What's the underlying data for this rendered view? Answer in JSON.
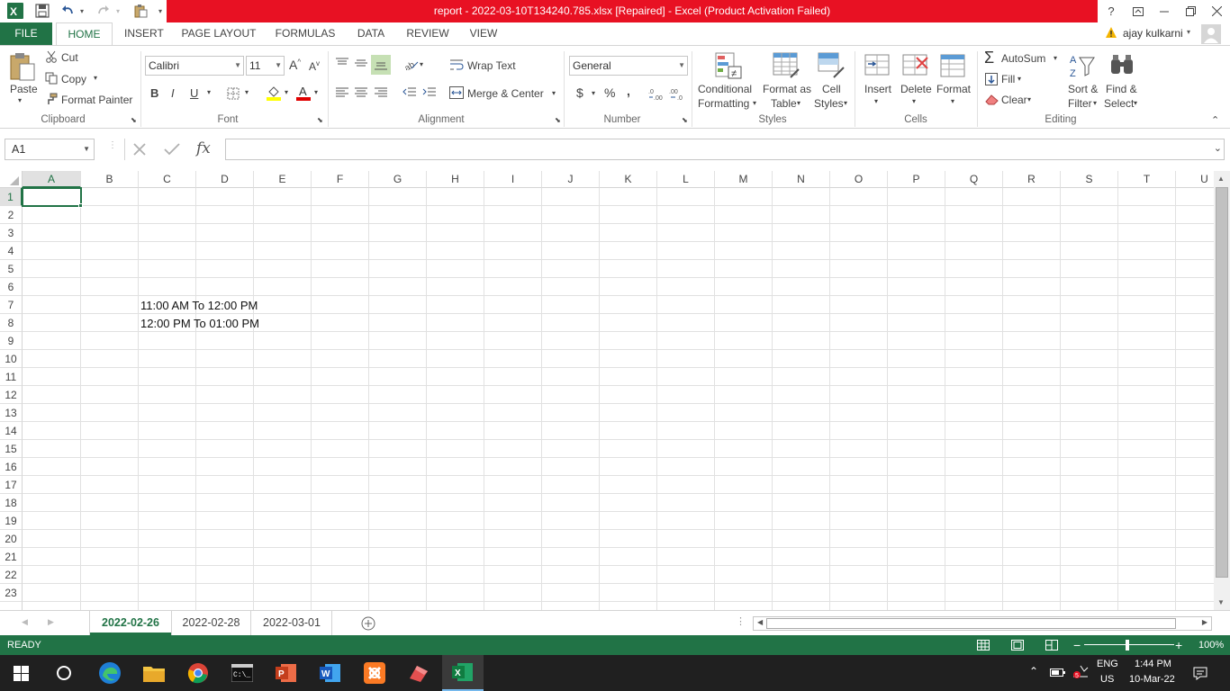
{
  "window": {
    "title": "report - 2022-03-10T134240.785.xlsx [Repaired] -  Excel (Product Activation Failed)",
    "help": "?",
    "user": "ajay kulkarni"
  },
  "tabs": [
    "FILE",
    "HOME",
    "INSERT",
    "PAGE LAYOUT",
    "FORMULAS",
    "DATA",
    "REVIEW",
    "VIEW"
  ],
  "clipboard": {
    "paste": "Paste",
    "cut": "Cut",
    "copy": "Copy",
    "format_painter": "Format Painter",
    "label": "Clipboard"
  },
  "font": {
    "name": "Calibri",
    "size": "11",
    "bold": "B",
    "italic": "I",
    "underline": "U",
    "label": "Font"
  },
  "alignment": {
    "wrap": "Wrap Text",
    "merge": "Merge & Center",
    "label": "Alignment"
  },
  "number": {
    "format": "General",
    "currency": "$",
    "percent": "%",
    "comma": ",",
    "label": "Number"
  },
  "styles": {
    "conditional": [
      "Conditional",
      "Formatting"
    ],
    "format_table": [
      "Format as",
      "Table"
    ],
    "cell_styles": [
      "Cell",
      "Styles"
    ],
    "label": "Styles"
  },
  "cells": {
    "insert": "Insert",
    "delete": "Delete",
    "format": "Format",
    "label": "Cells"
  },
  "editing": {
    "autosum": "AutoSum",
    "fill": "Fill",
    "clear": "Clear",
    "sort": [
      "Sort &",
      "Filter"
    ],
    "find": [
      "Find &",
      "Select"
    ],
    "label": "Editing"
  },
  "formula_bar": {
    "name_box": "A1",
    "fx": "fx",
    "value": ""
  },
  "columns": [
    "A",
    "B",
    "C",
    "D",
    "E",
    "F",
    "G",
    "H",
    "I",
    "J",
    "K",
    "L",
    "M",
    "N",
    "O",
    "P",
    "Q",
    "R",
    "S",
    "T",
    "U"
  ],
  "rows": [
    "1",
    "2",
    "3",
    "4",
    "5",
    "6",
    "7",
    "8",
    "9",
    "10",
    "11",
    "12",
    "13",
    "14",
    "15",
    "16",
    "17",
    "18",
    "19",
    "20",
    "21",
    "22",
    "23"
  ],
  "cells_data": [
    {
      "ref": "C7",
      "text": "11:00 AM To 12:00 PM"
    },
    {
      "ref": "C8",
      "text": "12:00 PM To 01:00 PM"
    }
  ],
  "sheets": [
    "2022-02-26",
    "2022-02-28",
    "2022-03-01"
  ],
  "active_sheet": "2022-02-26",
  "status": {
    "mode": "READY",
    "zoom": "100%"
  },
  "taskbar": {
    "lang1": "ENG",
    "lang2": "US",
    "time": "1:44 PM",
    "date": "10-Mar-22"
  },
  "colors": {
    "excel_green": "#217346",
    "title_red": "#e81123",
    "taskbar": "#202020"
  }
}
